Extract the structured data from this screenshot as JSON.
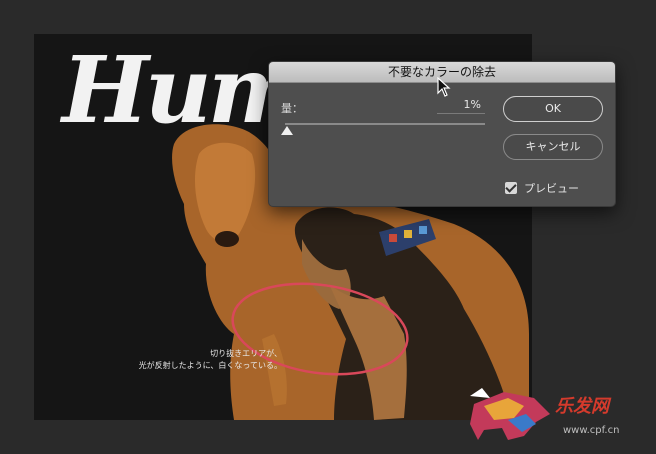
{
  "canvas": {
    "hero_title": "Hum",
    "caption_line1": "切り抜きエリアが、",
    "caption_line2": "光が反射したように、白くなっている。"
  },
  "dialog": {
    "title": "不要なカラーの除去",
    "amount_label": "量：",
    "amount_value": "1%",
    "amount_percent": 1,
    "ok_label": "OK",
    "cancel_label": "キャンセル",
    "preview_label": "プレビュー",
    "preview_checked": true
  },
  "watermark": {
    "text": "乐发网",
    "url": "www.cpf.cn"
  },
  "colors": {
    "annotation_ellipse": "#d9485a",
    "dialog_bg": "#4e4e4e",
    "canvas_bg": "#151515"
  }
}
